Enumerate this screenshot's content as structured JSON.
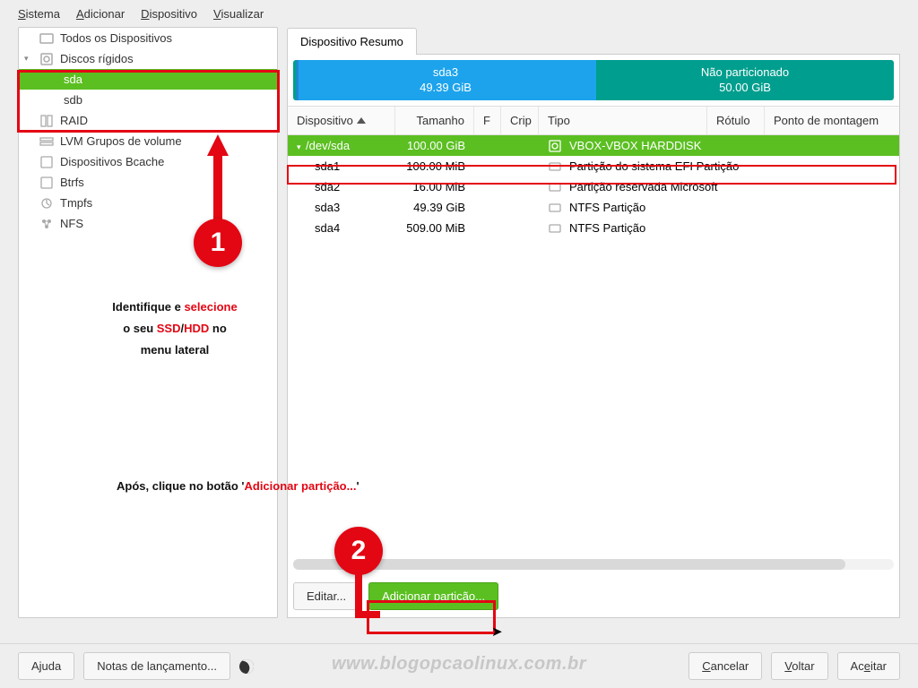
{
  "menu": {
    "sistema": "Sistema",
    "adicionar": "Adicionar",
    "dispositivo": "Dispositivo",
    "visualizar": "Visualizar"
  },
  "sidebar": {
    "all": "Todos os Dispositivos",
    "hd": "Discos rígidos",
    "sda": "sda",
    "sdb": "sdb",
    "raid": "RAID",
    "lvm": "LVM Grupos de volume",
    "bcache": "Dispositivos Bcache",
    "btrfs": "Btrfs",
    "tmpfs": "Tmpfs",
    "nfs": "NFS"
  },
  "tab": {
    "summary": "Dispositivo Resumo"
  },
  "diskbar": {
    "seg1_name": "sda3",
    "seg1_size": "49.39 GiB",
    "seg2_name": "Não particionado",
    "seg2_size": "50.00 GiB"
  },
  "cols": {
    "device": "Dispositivo",
    "size": "Tamanho",
    "f": "F",
    "crip": "Crip",
    "type": "Tipo",
    "label": "Rótulo",
    "mount": "Ponto de montagem"
  },
  "rows": [
    {
      "dev": "/dev/sda",
      "size": "100.00 GiB",
      "type": "VBOX-VBOX HARDDISK"
    },
    {
      "dev": "sda1",
      "size": "100.00 MiB",
      "type": "Partição do sistema EFI Partição"
    },
    {
      "dev": "sda2",
      "size": "16.00 MiB",
      "type": "Partição reservada Microsoft"
    },
    {
      "dev": "sda3",
      "size": "49.39 GiB",
      "type": "NTFS Partição"
    },
    {
      "dev": "sda4",
      "size": "509.00 MiB",
      "type": "NTFS Partição"
    }
  ],
  "buttons": {
    "edit": "Editar...",
    "add": "Adicionar partição..."
  },
  "bottom": {
    "help": "Ajuda",
    "notes": "Notas de lançamento...",
    "cancel": "Cancelar",
    "back": "Voltar",
    "accept": "Aceitar"
  },
  "annot": {
    "line1a": "Identifique e ",
    "line1b": "selecione",
    "line2a": "o seu ",
    "line2b": "SSD",
    "line2c": "/",
    "line2d": "HDD",
    "line2e": " no",
    "line3": "menu lateral",
    "after1": "Após, clique no botão '",
    "after2": "Adicionar partição...",
    "after3": "'",
    "m1": "1",
    "m2": "2"
  },
  "watermark": "www.blogopcaolinux.com.br"
}
